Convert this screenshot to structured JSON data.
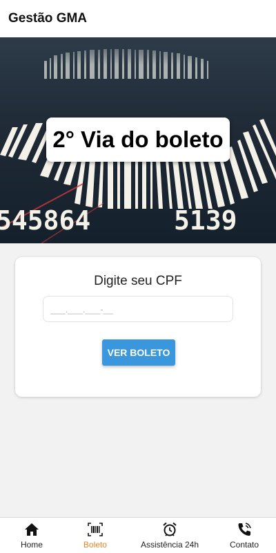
{
  "app_bar": {
    "title": "Gestão GMA"
  },
  "hero": {
    "title": "2° Via do boleto",
    "barcode_digits_left": "545864",
    "barcode_digits_right": "5139"
  },
  "form": {
    "label": "Digite seu CPF",
    "cpf_placeholder": "___.___.___-__",
    "cpf_value": "",
    "submit_label": "VER BOLETO"
  },
  "bottom_nav": {
    "items": [
      {
        "label": "Home",
        "icon": "home-icon",
        "active": false
      },
      {
        "label": "Boleto",
        "icon": "barcode-icon",
        "active": true
      },
      {
        "label": "Assistência 24h",
        "icon": "alarm-clock-icon",
        "active": false
      },
      {
        "label": "Contato",
        "icon": "phone-icon",
        "active": false
      }
    ]
  },
  "colors": {
    "accent": "#e8862a",
    "button": "#3a97dd"
  }
}
